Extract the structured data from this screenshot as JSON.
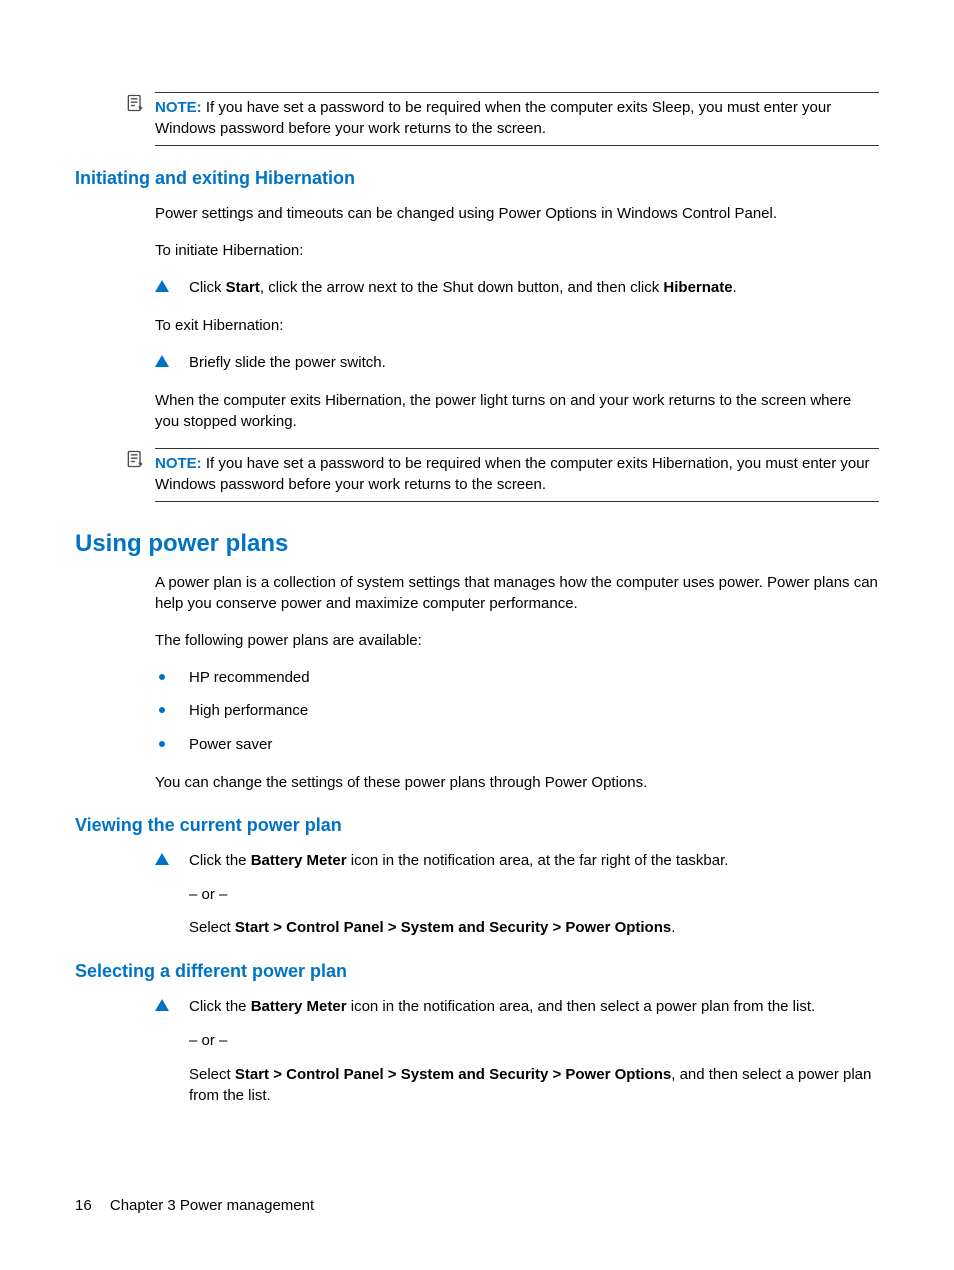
{
  "note1": {
    "label": "NOTE:",
    "text": "If you have set a password to be required when the computer exits Sleep, you must enter your Windows password before your work returns to the screen."
  },
  "s1": {
    "heading": "Initiating and exiting Hibernation",
    "p1": "Power settings and timeouts can be changed using Power Options in Windows Control Panel.",
    "p2": "To initiate Hibernation:",
    "step1_pre": "Click ",
    "step1_b1": "Start",
    "step1_mid": ", click the arrow next to the Shut down button, and then click ",
    "step1_b2": "Hibernate",
    "step1_post": ".",
    "p3": "To exit Hibernation:",
    "step2": "Briefly slide the power switch.",
    "p4": "When the computer exits Hibernation, the power light turns on and your work returns to the screen where you stopped working."
  },
  "note2": {
    "label": "NOTE:",
    "text": "If you have set a password to be required when the computer exits Hibernation, you must enter your Windows password before your work returns to the screen."
  },
  "s2": {
    "heading": "Using power plans",
    "p1": "A power plan is a collection of system settings that manages how the computer uses power. Power plans can help you conserve power and maximize computer performance.",
    "p2": "The following power plans are available:",
    "bullets": [
      "HP recommended",
      "High performance",
      "Power saver"
    ],
    "p3": "You can change the settings of these power plans through Power Options."
  },
  "s3": {
    "heading": "Viewing the current power plan",
    "step_pre": "Click the ",
    "step_b1": "Battery Meter",
    "step_post": " icon in the notification area, at the far right of the taskbar.",
    "or": "– or –",
    "sel_pre": "Select ",
    "sel_b": "Start > Control Panel > System and Security > Power Options",
    "sel_post": "."
  },
  "s4": {
    "heading": "Selecting a different power plan",
    "step_pre": "Click the ",
    "step_b1": "Battery Meter",
    "step_post": " icon in the notification area, and then select a power plan from the list.",
    "or": "– or –",
    "sel_pre": "Select ",
    "sel_b": "Start > Control Panel > System and Security > Power Options",
    "sel_post": ", and then select a power plan from the list."
  },
  "footer": {
    "page": "16",
    "chapter": "Chapter 3   Power management"
  }
}
